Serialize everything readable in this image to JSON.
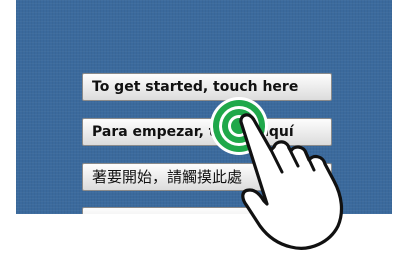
{
  "buttons": [
    {
      "label": "To get started, touch here"
    },
    {
      "label": "Para empezar, toque aquí"
    },
    {
      "label": "著要開始，請觸摸此處"
    }
  ],
  "touch_indicator": {
    "icon": "hand-pointer-icon",
    "ring_color": "#1fa84a"
  },
  "colors": {
    "screen_bg": "#3b6a9d"
  }
}
